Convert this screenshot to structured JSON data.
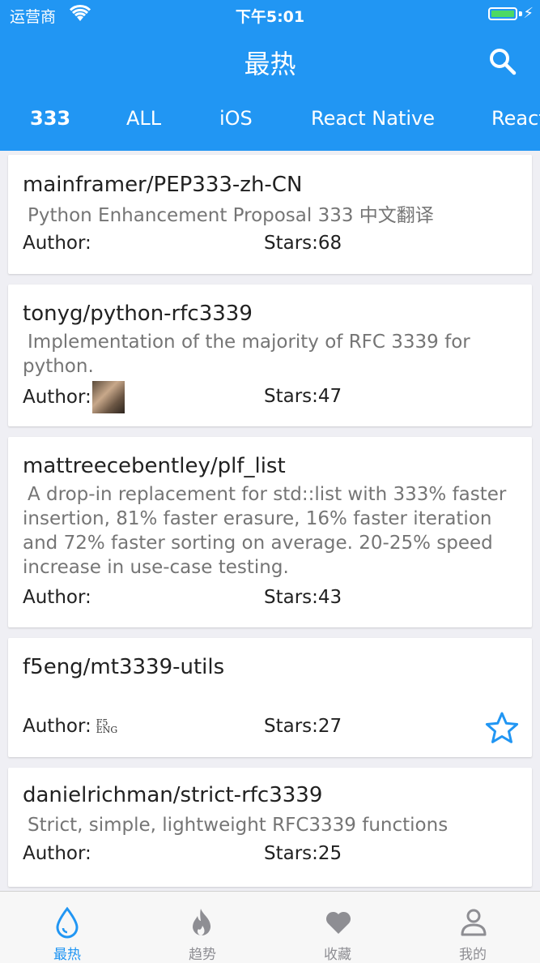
{
  "status_bar": {
    "carrier": "运营商",
    "time": "下午5:01"
  },
  "header": {
    "title": "最热"
  },
  "tabs": [
    {
      "label": "333"
    },
    {
      "label": "ALL"
    },
    {
      "label": "iOS"
    },
    {
      "label": "React Native"
    },
    {
      "label": "React"
    }
  ],
  "repos": [
    {
      "name": "mainframer/PEP333-zh-CN",
      "description": "Python Enhancement Proposal 333 中文翻译",
      "author_label": "Author:",
      "stars_label": "Stars:68"
    },
    {
      "name": "tonyg/python-rfc3339",
      "description": "Implementation of the majority of RFC 3339 for python.",
      "author_label": "Author:",
      "stars_label": "Stars:47"
    },
    {
      "name": "mattreecebentley/plf_list",
      "description": "A drop-in replacement for std::list with 333% faster insertion, 81% faster erasure, 16% faster iteration and 72% faster sorting on average. 20-25% speed increase in use-case testing.",
      "author_label": "Author:",
      "stars_label": "Stars:43"
    },
    {
      "name": "f5eng/mt3339-utils",
      "description": "",
      "author_label": "Author:",
      "stars_label": "Stars:27",
      "avatar_text": "F5 ENG"
    },
    {
      "name": "danielrichman/strict-rfc3339",
      "description": "Strict, simple, lightweight RFC3339 functions",
      "author_label": "Author:",
      "stars_label": "Stars:25"
    }
  ],
  "bottom_nav": [
    {
      "label": "最热",
      "icon": "drop-icon"
    },
    {
      "label": "趋势",
      "icon": "flame-icon"
    },
    {
      "label": "收藏",
      "icon": "heart-icon"
    },
    {
      "label": "我的",
      "icon": "person-icon"
    }
  ],
  "colors": {
    "primary": "#2196f3",
    "inactive": "#8e8e93",
    "background": "#efeff4"
  }
}
